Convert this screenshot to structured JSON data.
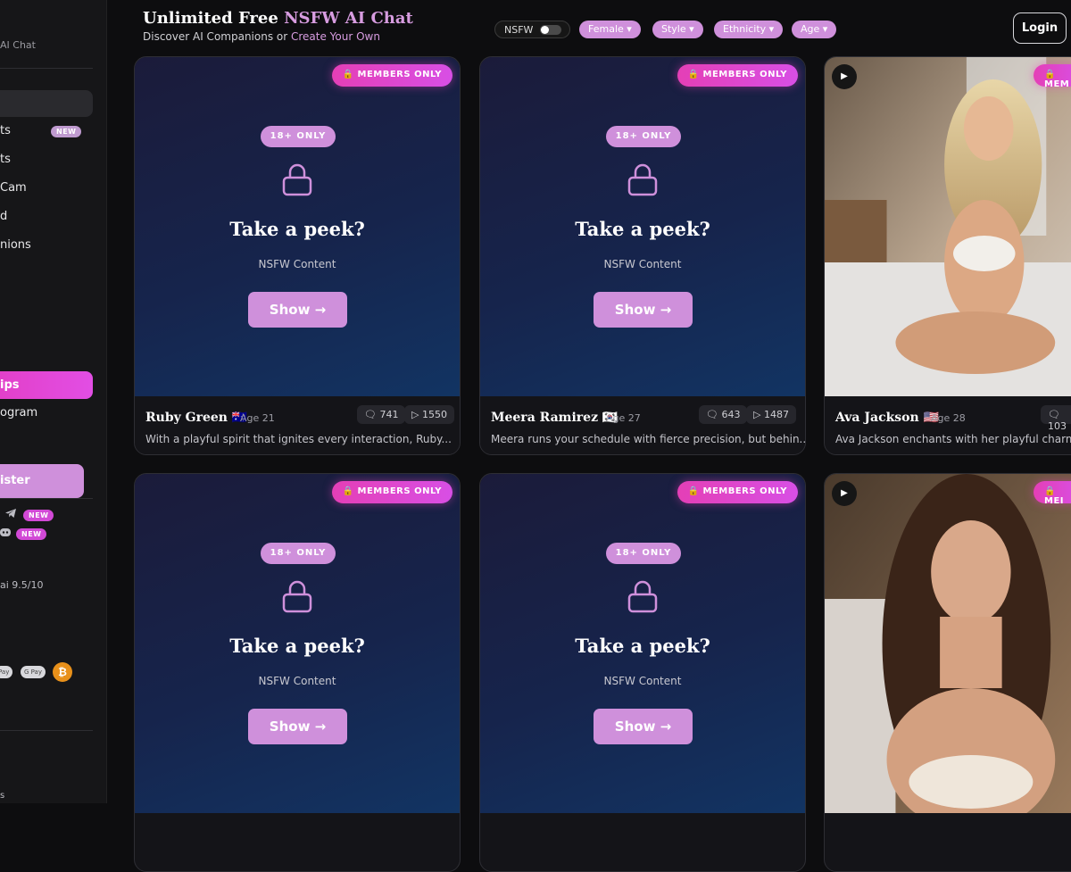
{
  "sidebar": {
    "tagline": "AI Chat",
    "items": [
      {
        "label": "ts",
        "badge": "NEW"
      },
      {
        "label": "ts"
      },
      {
        "label": "Cam"
      },
      {
        "label": "d"
      },
      {
        "label": "nions"
      }
    ],
    "upgrade_label": "ips",
    "affiliate_label": "ogram",
    "register_label": "ister",
    "social": [
      {
        "icon": "telegram-icon",
        "badge": "NEW"
      },
      {
        "icon": "discord-icon",
        "badge": "NEW"
      }
    ],
    "rating_text": "ai 9.5/10",
    "payments": [
      "Pay",
      "G Pay"
    ],
    "btc_symbol": "₿",
    "bottom_text": "s"
  },
  "header": {
    "title_plain": "Unlimited Free ",
    "title_accent": "NSFW AI Chat",
    "subtitle_plain": "Discover AI Companions or ",
    "subtitle_link": "Create Your Own",
    "login_label": "Login"
  },
  "filters": {
    "nsfw_label": "NSFW",
    "chips": [
      "Female ▾",
      "Style ▾",
      "Ethnicity ▾",
      "Age ▾"
    ]
  },
  "cards": [
    {
      "type": "locked",
      "members": "MEMBERS ONLY",
      "age_badge": "18+ ONLY",
      "peek": "Take a peek?",
      "nsfw": "NSFW Content",
      "show": "Show →",
      "name": "Ruby Green 🇦🇺",
      "age": "Age 21",
      "msgs": "741",
      "views": "1550",
      "desc": "With a playful spirit that ignites every interaction, Ruby..."
    },
    {
      "type": "locked",
      "members": "MEMBERS ONLY",
      "age_badge": "18+ ONLY",
      "peek": "Take a peek?",
      "nsfw": "NSFW Content",
      "show": "Show →",
      "name": "Meera Ramirez 🇰🇷",
      "age": "Age 27",
      "msgs": "643",
      "views": "1487",
      "desc": "Meera runs your schedule with fierce precision, but behin..."
    },
    {
      "type": "photo",
      "members": "MEM",
      "name": "Ava Jackson 🇺🇸",
      "age": "Age 28",
      "msgs": "103",
      "desc": "Ava Jackson enchants with her playful charm,"
    },
    {
      "type": "locked",
      "members": "MEMBERS ONLY",
      "age_badge": "18+ ONLY",
      "peek": "Take a peek?",
      "nsfw": "NSFW Content",
      "show": "Show →"
    },
    {
      "type": "locked",
      "members": "MEMBERS ONLY",
      "age_badge": "18+ ONLY",
      "peek": "Take a peek?",
      "nsfw": "NSFW Content",
      "show": "Show →"
    },
    {
      "type": "photo",
      "members": "MEI"
    }
  ],
  "colors": {
    "accent": "#d79ce0",
    "pink": "#e43fb6",
    "card_bg": "#16244c"
  }
}
